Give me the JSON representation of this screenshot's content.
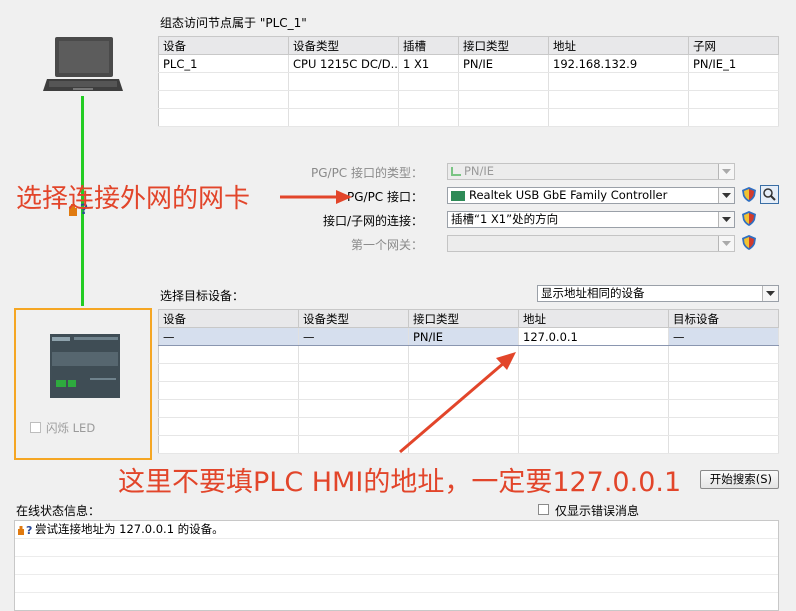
{
  "colors": {
    "annotation": "#e2452a",
    "link_line": "#22cc22",
    "highlight_box": "#f5a623",
    "selection": "#d6dfee"
  },
  "access_table": {
    "caption": "组态访问节点属于 \"PLC_1\"",
    "headers": [
      "设备",
      "设备类型",
      "插槽",
      "接口类型",
      "地址",
      "子网"
    ],
    "rows": [
      [
        "PLC_1",
        "CPU 1215C DC/D...",
        "1 X1",
        "PN/IE",
        "192.168.132.9",
        "PN/IE_1"
      ]
    ]
  },
  "interface_form": {
    "pgpc_type_label": "PG/PC 接口的类型：",
    "pgpc_type_value": "PN/IE",
    "pgpc_interface_label": "PG/PC 接口：",
    "pgpc_interface_value": "Realtek USB GbE Family Controller",
    "subnet_conn_label": "接口/子网的连接：",
    "subnet_conn_value": "插槽“1 X1”处的方向",
    "gateway_label": "第一个网关："
  },
  "target_section": {
    "caption": "选择目标设备：",
    "filter_value": "显示地址相同的设备",
    "headers": [
      "设备",
      "设备类型",
      "接口类型",
      "地址",
      "目标设备"
    ],
    "rows": [
      [
        "—",
        "—",
        "PN/IE",
        "127.0.0.1",
        "—"
      ]
    ]
  },
  "device_panel": {
    "flash_led_label": "闪烁 LED"
  },
  "start_search_button": "开始搜索(S)",
  "online_status": {
    "caption": "在线状态信息：",
    "errors_only_label": "仅显示错误消息",
    "messages": [
      "尝试连接地址为 127.0.0.1 的设备。"
    ]
  },
  "annotations": {
    "nic_hint": "选择连接外网的网卡",
    "address_hint": "这里不要填PLC HMI的地址，一定要127.0.0.1"
  }
}
